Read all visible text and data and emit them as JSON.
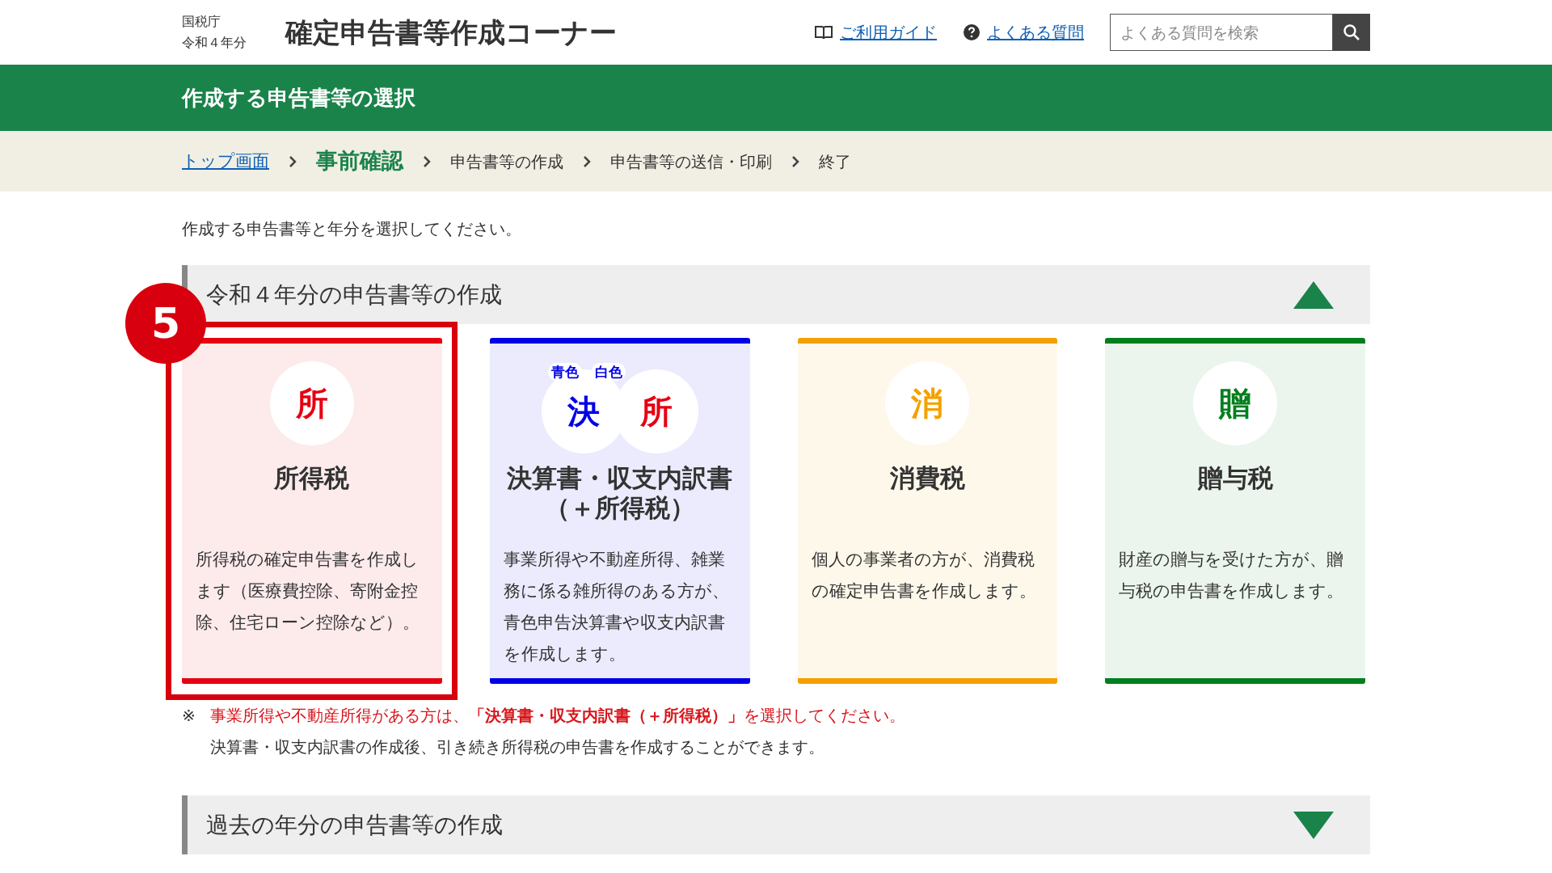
{
  "header": {
    "agency": "国税庁",
    "year": "令和４年分",
    "title": "確定申告書等作成コーナー",
    "links": [
      {
        "label": "ご利用ガイド",
        "kind": "guide"
      },
      {
        "label": "よくある質問",
        "kind": "faq"
      }
    ],
    "search": {
      "placeholder": "よくある質問を検索"
    }
  },
  "banner": {
    "title": "作成する申告書等の選択"
  },
  "breadcrumb": [
    {
      "label": "トップ画面",
      "kind": "link"
    },
    {
      "label": "事前確認",
      "kind": "current"
    },
    {
      "label": "申告書等の作成",
      "kind": "step"
    },
    {
      "label": "申告書等の送信・印刷",
      "kind": "step"
    },
    {
      "label": "終了",
      "kind": "step"
    }
  ],
  "intro": "作成する申告書等と年分を選択してください。",
  "sections": [
    {
      "title": "令和４年分の申告書等の作成",
      "expanded": true,
      "cards": [
        {
          "color": "#e60012",
          "highlighted": true,
          "callout": "5",
          "icons": [
            {
              "char": "所",
              "color": "#e60012"
            }
          ],
          "title": "所得税",
          "description": "所得税の確定申告書を作成します（医療費控除、寄附金控除、住宅ローン控除など）。"
        },
        {
          "color": "#0000e6",
          "highlighted": false,
          "icons": [
            {
              "char": "決",
              "color": "#0000e6"
            },
            {
              "char": "所",
              "color": "#e60012"
            }
          ],
          "tags": [
            "青色",
            "白色"
          ],
          "title": "決算書・収支内訳書（＋所得税）",
          "description": "事業所得や不動産所得、雑業務に係る雑所得のある方が、青色申告決算書や収支内訳書を作成します。"
        },
        {
          "color": "#f5a000",
          "highlighted": false,
          "icons": [
            {
              "char": "消",
              "color": "#f5a000"
            }
          ],
          "title": "消費税",
          "description": "個人の事業者の方が、消費税の確定申告書を作成します。"
        },
        {
          "color": "#007f1e",
          "highlighted": false,
          "icons": [
            {
              "char": "贈",
              "color": "#007f1e"
            }
          ],
          "title": "贈与税",
          "description": "財産の贈与を受けた方が、贈与税の申告書を作成します。"
        }
      ],
      "note": {
        "mark": "※",
        "warning": "事業所得や不動産所得がある方は、**「決算書・収支内訳書（＋所得税）」**を選択してください。",
        "detail": "決算書・収支内訳書の作成後、引き続き所得税の申告書を作成することができます。"
      }
    },
    {
      "title": "過去の年分の申告書等の作成",
      "expanded": false
    }
  ]
}
